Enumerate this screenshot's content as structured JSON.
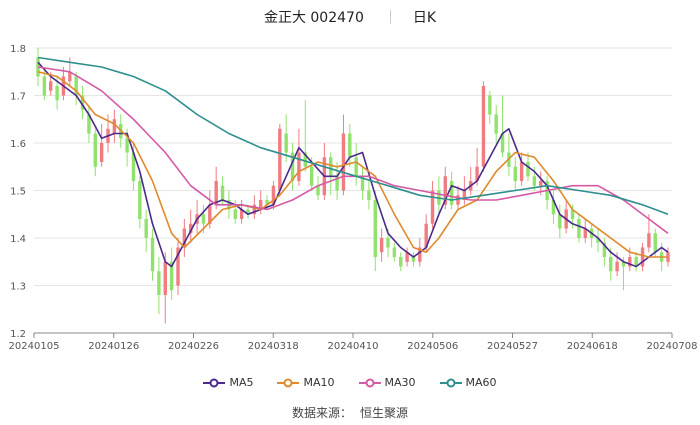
{
  "header": {
    "title": "金正大 002470",
    "period": "日K"
  },
  "legend": [
    {
      "name": "MA5",
      "color": "#4b2a8c"
    },
    {
      "name": "MA10",
      "color": "#e08a2e"
    },
    {
      "name": "MA30",
      "color": "#d45aa6"
    },
    {
      "name": "MA60",
      "color": "#2f8f8f"
    }
  ],
  "source": {
    "label": "数据来源：",
    "name": "恒生聚源"
  },
  "chart_data": {
    "type": "candlestick",
    "ylim": [
      1.2,
      1.8
    ],
    "yticks": [
      "1.2",
      "1.3",
      "1.4",
      "1.5",
      "1.6",
      "1.7",
      "1.8"
    ],
    "xticks": [
      "20240105",
      "20240126",
      "20240226",
      "20240318",
      "20240410",
      "20240506",
      "20240527",
      "20240618",
      "20240708"
    ],
    "colors": {
      "up": "#f07c82",
      "down": "#90e26c"
    },
    "candles": [
      [
        1.78,
        1.74,
        1.8,
        1.72
      ],
      [
        1.74,
        1.7,
        1.76,
        1.69
      ],
      [
        1.71,
        1.73,
        1.75,
        1.7
      ],
      [
        1.72,
        1.69,
        1.74,
        1.67
      ],
      [
        1.7,
        1.74,
        1.76,
        1.69
      ],
      [
        1.73,
        1.75,
        1.78,
        1.72
      ],
      [
        1.74,
        1.7,
        1.75,
        1.68
      ],
      [
        1.7,
        1.67,
        1.72,
        1.65
      ],
      [
        1.66,
        1.62,
        1.68,
        1.6
      ],
      [
        1.62,
        1.55,
        1.63,
        1.53
      ],
      [
        1.56,
        1.6,
        1.64,
        1.55
      ],
      [
        1.6,
        1.63,
        1.66,
        1.58
      ],
      [
        1.62,
        1.65,
        1.67,
        1.6
      ],
      [
        1.64,
        1.61,
        1.66,
        1.59
      ],
      [
        1.61,
        1.58,
        1.63,
        1.55
      ],
      [
        1.58,
        1.52,
        1.6,
        1.5
      ],
      [
        1.52,
        1.44,
        1.53,
        1.42
      ],
      [
        1.44,
        1.4,
        1.46,
        1.37
      ],
      [
        1.4,
        1.33,
        1.42,
        1.31
      ],
      [
        1.33,
        1.28,
        1.36,
        1.24
      ],
      [
        1.28,
        1.35,
        1.37,
        1.22
      ],
      [
        1.35,
        1.29,
        1.38,
        1.27
      ],
      [
        1.3,
        1.38,
        1.4,
        1.28
      ],
      [
        1.38,
        1.42,
        1.44,
        1.36
      ],
      [
        1.41,
        1.43,
        1.46,
        1.39
      ],
      [
        1.43,
        1.45,
        1.48,
        1.41
      ],
      [
        1.45,
        1.43,
        1.47,
        1.41
      ],
      [
        1.43,
        1.47,
        1.5,
        1.42
      ],
      [
        1.47,
        1.52,
        1.55,
        1.46
      ],
      [
        1.51,
        1.48,
        1.53,
        1.47
      ],
      [
        1.48,
        1.46,
        1.5,
        1.44
      ],
      [
        1.46,
        1.44,
        1.48,
        1.43
      ],
      [
        1.44,
        1.46,
        1.48,
        1.43
      ],
      [
        1.46,
        1.45,
        1.47,
        1.44
      ],
      [
        1.45,
        1.47,
        1.49,
        1.44
      ],
      [
        1.46,
        1.48,
        1.5,
        1.45
      ],
      [
        1.48,
        1.47,
        1.49,
        1.46
      ],
      [
        1.47,
        1.51,
        1.52,
        1.46
      ],
      [
        1.5,
        1.63,
        1.64,
        1.49
      ],
      [
        1.62,
        1.58,
        1.66,
        1.56
      ],
      [
        1.58,
        1.52,
        1.6,
        1.5
      ],
      [
        1.52,
        1.58,
        1.63,
        1.51
      ],
      [
        1.58,
        1.55,
        1.69,
        1.54
      ],
      [
        1.55,
        1.51,
        1.57,
        1.5
      ],
      [
        1.51,
        1.49,
        1.53,
        1.48
      ],
      [
        1.49,
        1.57,
        1.6,
        1.48
      ],
      [
        1.57,
        1.53,
        1.58,
        1.49
      ],
      [
        1.53,
        1.5,
        1.56,
        1.48
      ],
      [
        1.5,
        1.62,
        1.66,
        1.49
      ],
      [
        1.62,
        1.57,
        1.64,
        1.55
      ],
      [
        1.57,
        1.53,
        1.6,
        1.51
      ],
      [
        1.53,
        1.5,
        1.55,
        1.48
      ],
      [
        1.5,
        1.48,
        1.52,
        1.46
      ],
      [
        1.48,
        1.36,
        1.5,
        1.33
      ],
      [
        1.37,
        1.4,
        1.42,
        1.35
      ],
      [
        1.4,
        1.38,
        1.42,
        1.36
      ],
      [
        1.38,
        1.36,
        1.39,
        1.35
      ],
      [
        1.36,
        1.34,
        1.37,
        1.33
      ],
      [
        1.35,
        1.37,
        1.38,
        1.34
      ],
      [
        1.36,
        1.35,
        1.37,
        1.34
      ],
      [
        1.35,
        1.38,
        1.4,
        1.34
      ],
      [
        1.38,
        1.43,
        1.45,
        1.37
      ],
      [
        1.43,
        1.5,
        1.52,
        1.42
      ],
      [
        1.5,
        1.47,
        1.53,
        1.45
      ],
      [
        1.47,
        1.53,
        1.55,
        1.46
      ],
      [
        1.52,
        1.47,
        1.54,
        1.46
      ],
      [
        1.47,
        1.49,
        1.51,
        1.46
      ],
      [
        1.48,
        1.5,
        1.53,
        1.47
      ],
      [
        1.5,
        1.52,
        1.55,
        1.49
      ],
      [
        1.52,
        1.55,
        1.59,
        1.51
      ],
      [
        1.55,
        1.72,
        1.73,
        1.54
      ],
      [
        1.7,
        1.66,
        1.71,
        1.64
      ],
      [
        1.66,
        1.62,
        1.68,
        1.6
      ],
      [
        1.62,
        1.58,
        1.7,
        1.57
      ],
      [
        1.58,
        1.55,
        1.62,
        1.53
      ],
      [
        1.55,
        1.52,
        1.57,
        1.5
      ],
      [
        1.52,
        1.56,
        1.58,
        1.51
      ],
      [
        1.56,
        1.53,
        1.58,
        1.52
      ],
      [
        1.53,
        1.51,
        1.55,
        1.5
      ],
      [
        1.51,
        1.52,
        1.54,
        1.49
      ],
      [
        1.52,
        1.48,
        1.53,
        1.46
      ],
      [
        1.48,
        1.45,
        1.5,
        1.43
      ],
      [
        1.45,
        1.42,
        1.47,
        1.4
      ],
      [
        1.42,
        1.46,
        1.48,
        1.41
      ],
      [
        1.46,
        1.44,
        1.47,
        1.42
      ],
      [
        1.44,
        1.4,
        1.45,
        1.39
      ],
      [
        1.4,
        1.42,
        1.44,
        1.39
      ],
      [
        1.42,
        1.4,
        1.43,
        1.38
      ],
      [
        1.4,
        1.39,
        1.42,
        1.37
      ],
      [
        1.39,
        1.36,
        1.4,
        1.34
      ],
      [
        1.36,
        1.33,
        1.38,
        1.31
      ],
      [
        1.33,
        1.35,
        1.37,
        1.32
      ],
      [
        1.35,
        1.34,
        1.36,
        1.29
      ],
      [
        1.34,
        1.36,
        1.38,
        1.33
      ],
      [
        1.36,
        1.34,
        1.37,
        1.33
      ],
      [
        1.34,
        1.38,
        1.39,
        1.33
      ],
      [
        1.38,
        1.41,
        1.45,
        1.37
      ],
      [
        1.41,
        1.37,
        1.42,
        1.36
      ],
      [
        1.37,
        1.35,
        1.39,
        1.33
      ],
      [
        1.35,
        1.37,
        1.38,
        1.34
      ]
    ],
    "series": [
      {
        "name": "MA5",
        "color": "#4b2a8c",
        "points": [
          [
            0,
            1.77
          ],
          [
            2,
            1.74
          ],
          [
            4,
            1.72
          ],
          [
            6,
            1.7
          ],
          [
            8,
            1.66
          ],
          [
            10,
            1.61
          ],
          [
            12,
            1.62
          ],
          [
            14,
            1.62
          ],
          [
            16,
            1.54
          ],
          [
            18,
            1.43
          ],
          [
            20,
            1.35
          ],
          [
            21,
            1.34
          ],
          [
            23,
            1.39
          ],
          [
            25,
            1.44
          ],
          [
            27,
            1.47
          ],
          [
            29,
            1.48
          ],
          [
            31,
            1.47
          ],
          [
            33,
            1.45
          ],
          [
            35,
            1.46
          ],
          [
            37,
            1.47
          ],
          [
            39,
            1.53
          ],
          [
            41,
            1.59
          ],
          [
            43,
            1.56
          ],
          [
            45,
            1.53
          ],
          [
            47,
            1.53
          ],
          [
            49,
            1.57
          ],
          [
            51,
            1.58
          ],
          [
            53,
            1.49
          ],
          [
            55,
            1.41
          ],
          [
            57,
            1.38
          ],
          [
            59,
            1.36
          ],
          [
            61,
            1.38
          ],
          [
            63,
            1.45
          ],
          [
            65,
            1.51
          ],
          [
            67,
            1.5
          ],
          [
            69,
            1.52
          ],
          [
            71,
            1.57
          ],
          [
            73,
            1.62
          ],
          [
            74,
            1.63
          ],
          [
            76,
            1.56
          ],
          [
            78,
            1.54
          ],
          [
            80,
            1.51
          ],
          [
            82,
            1.45
          ],
          [
            84,
            1.43
          ],
          [
            86,
            1.42
          ],
          [
            88,
            1.4
          ],
          [
            90,
            1.37
          ],
          [
            92,
            1.35
          ],
          [
            94,
            1.34
          ],
          [
            96,
            1.36
          ],
          [
            98,
            1.38
          ],
          [
            99,
            1.37
          ]
        ]
      },
      {
        "name": "MA10",
        "color": "#e08a2e",
        "points": [
          [
            0,
            1.75
          ],
          [
            3,
            1.74
          ],
          [
            6,
            1.71
          ],
          [
            9,
            1.66
          ],
          [
            12,
            1.64
          ],
          [
            15,
            1.6
          ],
          [
            18,
            1.52
          ],
          [
            21,
            1.41
          ],
          [
            23,
            1.38
          ],
          [
            26,
            1.42
          ],
          [
            29,
            1.46
          ],
          [
            32,
            1.47
          ],
          [
            35,
            1.46
          ],
          [
            38,
            1.49
          ],
          [
            41,
            1.54
          ],
          [
            44,
            1.56
          ],
          [
            47,
            1.55
          ],
          [
            50,
            1.56
          ],
          [
            53,
            1.53
          ],
          [
            56,
            1.45
          ],
          [
            59,
            1.38
          ],
          [
            61,
            1.37
          ],
          [
            63,
            1.4
          ],
          [
            66,
            1.46
          ],
          [
            69,
            1.48
          ],
          [
            72,
            1.54
          ],
          [
            75,
            1.58
          ],
          [
            78,
            1.57
          ],
          [
            81,
            1.52
          ],
          [
            84,
            1.46
          ],
          [
            87,
            1.43
          ],
          [
            90,
            1.4
          ],
          [
            93,
            1.37
          ],
          [
            96,
            1.36
          ],
          [
            99,
            1.36
          ]
        ]
      },
      {
        "name": "MA30",
        "color": "#d45aa6",
        "points": [
          [
            0,
            1.76
          ],
          [
            5,
            1.75
          ],
          [
            10,
            1.71
          ],
          [
            15,
            1.65
          ],
          [
            20,
            1.58
          ],
          [
            24,
            1.51
          ],
          [
            28,
            1.47
          ],
          [
            32,
            1.47
          ],
          [
            36,
            1.46
          ],
          [
            40,
            1.48
          ],
          [
            44,
            1.51
          ],
          [
            48,
            1.53
          ],
          [
            52,
            1.53
          ],
          [
            56,
            1.51
          ],
          [
            60,
            1.5
          ],
          [
            64,
            1.49
          ],
          [
            68,
            1.48
          ],
          [
            72,
            1.48
          ],
          [
            76,
            1.49
          ],
          [
            80,
            1.5
          ],
          [
            84,
            1.51
          ],
          [
            88,
            1.51
          ],
          [
            92,
            1.48
          ],
          [
            96,
            1.44
          ],
          [
            99,
            1.41
          ]
        ]
      },
      {
        "name": "MA60",
        "color": "#2f8f8f",
        "points": [
          [
            0,
            1.78
          ],
          [
            5,
            1.77
          ],
          [
            10,
            1.76
          ],
          [
            15,
            1.74
          ],
          [
            20,
            1.71
          ],
          [
            25,
            1.66
          ],
          [
            30,
            1.62
          ],
          [
            35,
            1.59
          ],
          [
            40,
            1.57
          ],
          [
            45,
            1.55
          ],
          [
            50,
            1.53
          ],
          [
            55,
            1.51
          ],
          [
            60,
            1.49
          ],
          [
            65,
            1.48
          ],
          [
            70,
            1.49
          ],
          [
            75,
            1.5
          ],
          [
            80,
            1.51
          ],
          [
            85,
            1.5
          ],
          [
            90,
            1.49
          ],
          [
            95,
            1.47
          ],
          [
            99,
            1.45
          ]
        ]
      }
    ]
  }
}
